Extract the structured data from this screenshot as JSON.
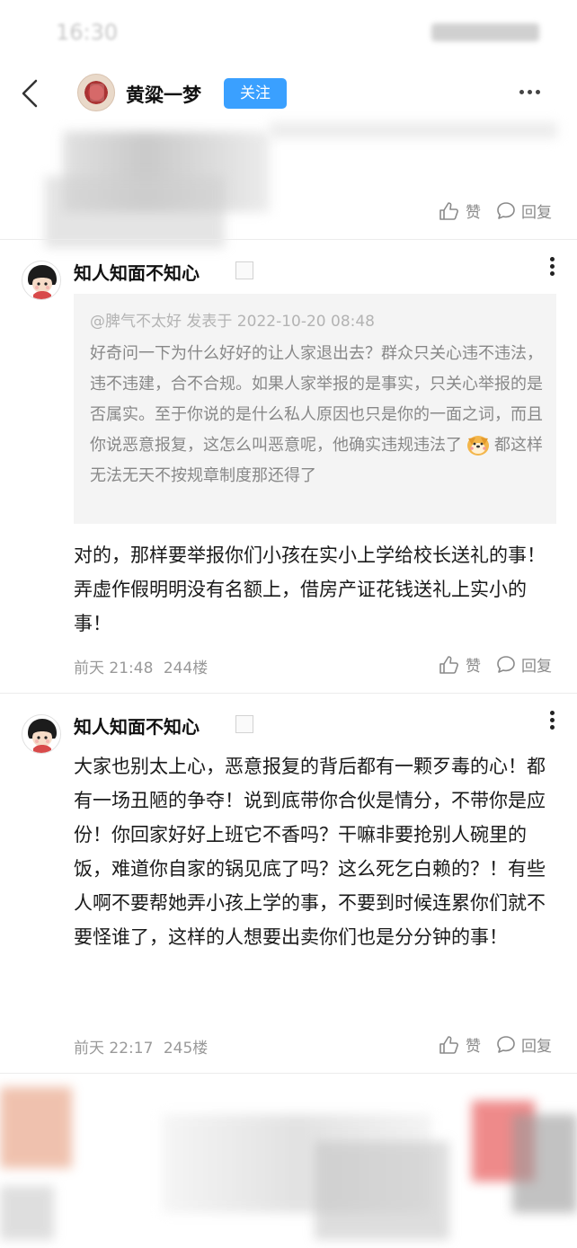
{
  "status_bar": {
    "time": "16:30"
  },
  "nav": {
    "author_name": "黄粱一梦",
    "follow_label": "关注"
  },
  "prev_comment": {
    "like_label": "赞",
    "reply_label": "回复"
  },
  "comments": [
    {
      "username": "知人知面不知心",
      "quote": {
        "header": "@脾气不太好 发表于 2022-10-20 08:48",
        "text_part1": "好奇问一下为什么好好的让人家退出去？群众只关心违不违法，违不违建，合不合规。如果人家举报的是事实，只关心举报的是否属实。至于你说的是什么私人原因也只是你的一面之词，而且你说恶意报复，这怎么叫恶意呢，他确实违规违法了",
        "emoji": "dog-face-emoji",
        "text_part2": "都这样无法无天不按规章制度那还得了"
      },
      "body": "对的，那样要举报你们小孩在实小上学给校长送礼的事！弄虚作假明明没有名额上，借房产证花钱送礼上实小的事！",
      "time": "前天 21:48",
      "floor": "244楼",
      "like_label": "赞",
      "reply_label": "回复"
    },
    {
      "username": "知人知面不知心",
      "body": "大家也别太上心，恶意报复的背后都有一颗歹毒的心！都有一场丑陋的争夺！说到底带你合伙是情分，不带你是应份！你回家好好上班它不香吗？干嘛非要抢别人碗里的饭，难道你自家的锅见底了吗？这么死乞白赖的？！有些人啊不要帮她弄小孩上学的事，不要到时候连累你们就不要怪谁了，这样的人想要出卖你们也是分分钟的事！",
      "time": "前天 22:17",
      "floor": "245楼",
      "like_label": "赞",
      "reply_label": "回复"
    }
  ],
  "colors": {
    "follow_button": "#3aa0ff",
    "quote_bg": "#f4f4f4",
    "meta_text": "#9a9a9a"
  }
}
